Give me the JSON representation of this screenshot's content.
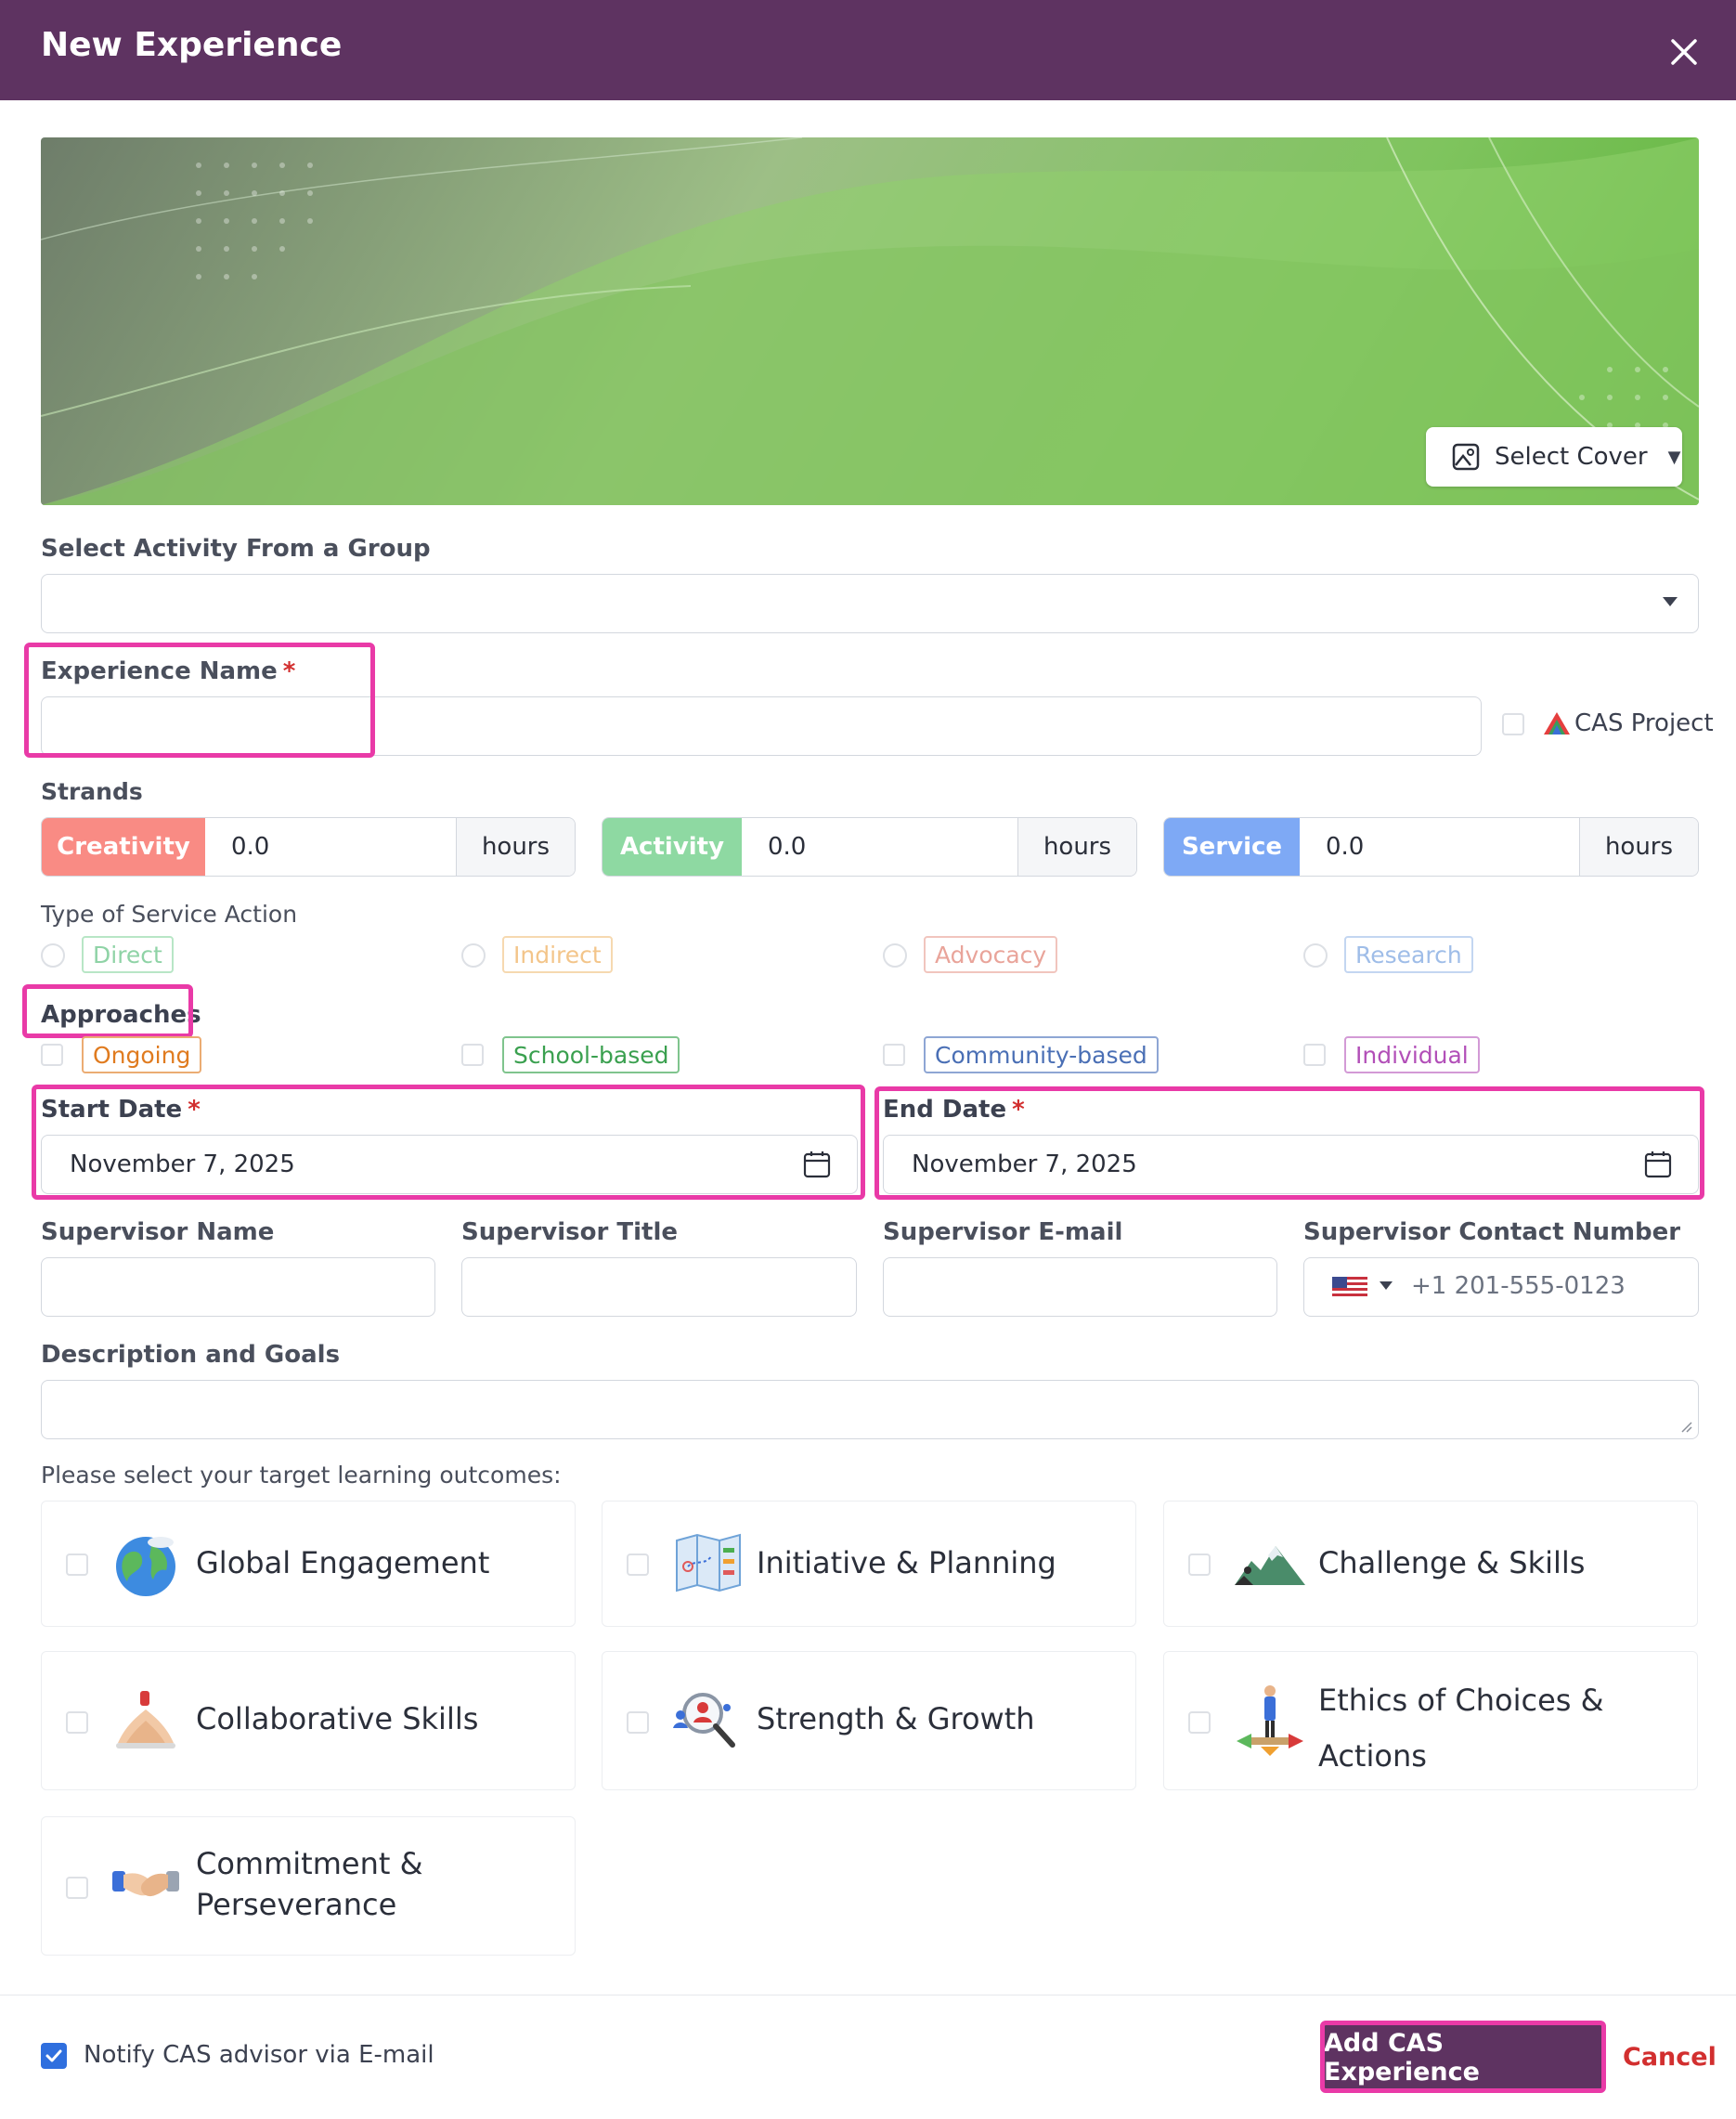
{
  "header": {
    "title": "New Experience"
  },
  "cover": {
    "select_label": "Select Cover"
  },
  "group": {
    "label": "Select Activity From a Group",
    "value": ""
  },
  "experience_name": {
    "label": "Experience Name",
    "required_mark": "*",
    "value": ""
  },
  "cas_project": {
    "label": "CAS Project"
  },
  "strands": {
    "label": "Strands",
    "items": [
      {
        "name": "Creativity",
        "value": "0.0",
        "unit": "hours",
        "color": "#f98b84"
      },
      {
        "name": "Activity",
        "value": "0.0",
        "unit": "hours",
        "color": "#8ed9a2"
      },
      {
        "name": "Service",
        "value": "0.0",
        "unit": "hours",
        "color": "#7ea9f5"
      }
    ]
  },
  "service_action": {
    "label": "Type of Service Action",
    "options": [
      {
        "label": "Direct",
        "color": "#8fd3a6"
      },
      {
        "label": "Indirect",
        "color": "#f3c58a"
      },
      {
        "label": "Advocacy",
        "color": "#e9a49a"
      },
      {
        "label": "Research",
        "color": "#9fbde8"
      }
    ]
  },
  "approaches": {
    "label": "Approaches",
    "options": [
      {
        "label": "Ongoing",
        "color": "#e07b1f"
      },
      {
        "label": "School-based",
        "color": "#3aa04f"
      },
      {
        "label": "Community-based",
        "color": "#4a6fb5"
      },
      {
        "label": "Individual",
        "color": "#b24fb8"
      }
    ]
  },
  "start_date": {
    "label": "Start Date",
    "required_mark": "*",
    "value": "November 7, 2025"
  },
  "end_date": {
    "label": "End Date",
    "required_mark": "*",
    "value": "November 7, 2025"
  },
  "supervisor": {
    "name_label": "Supervisor Name",
    "title_label": "Supervisor Title",
    "email_label": "Supervisor E-mail",
    "contact_label": "Supervisor Contact Number",
    "contact_placeholder": "+1 201-555-0123"
  },
  "description": {
    "label": "Description and Goals",
    "value": ""
  },
  "outcomes": {
    "label": "Please select your target learning outcomes:",
    "items": [
      {
        "label": "Global Engagement",
        "icon": "globe-icon"
      },
      {
        "label": "Initiative & Planning",
        "icon": "map-icon"
      },
      {
        "label": "Challenge & Skills",
        "icon": "mountain-icon"
      },
      {
        "label": "Collaborative Skills",
        "icon": "hands-stack-icon"
      },
      {
        "label": "Strength & Growth",
        "icon": "magnifier-people-icon"
      },
      {
        "label": "Ethics of Choices & Actions",
        "line1": "Ethics of Choices &",
        "line2": "Actions",
        "icon": "crossroads-person-icon"
      },
      {
        "label": "Commitment & Perseverance",
        "line1": "Commitment &",
        "line2": "Perseverance",
        "icon": "handshake-icon"
      }
    ]
  },
  "footer": {
    "notify_label": "Notify CAS advisor via E-mail",
    "notify_checked": true,
    "add_label": "Add CAS Experience",
    "cancel_label": "Cancel"
  },
  "colors": {
    "header": "#5e3361",
    "highlight": "#e93aa7",
    "cancel": "#d22f2f",
    "check": "#2f6fde"
  }
}
